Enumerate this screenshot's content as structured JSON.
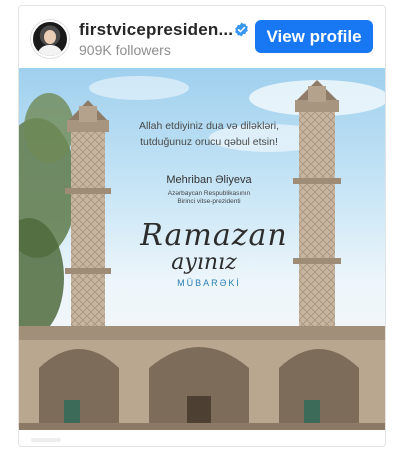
{
  "profile": {
    "username": "firstvicepresiden...",
    "followers": "909K followers",
    "view_profile_label": "View profile"
  },
  "post": {
    "message": "Allah etdiyiniz dua və diləkləri, tutduğunuz orucu qəbul etsin!",
    "signature_name": "Mehriban Əliyeva",
    "signature_role_line1": "Azərbaycan Respublikasının",
    "signature_role_line2": "Birinci vitse-prezidenti",
    "greeting_line1": "Ramazan",
    "greeting_line2": "ayınız",
    "greeting_line3": "MÜBARƏKİ"
  },
  "colors": {
    "brand_blue": "#1877f2",
    "verified_blue": "#3897f0",
    "accent": "#2a7fb3"
  },
  "icons": {
    "verified": "verified-badge-icon"
  }
}
